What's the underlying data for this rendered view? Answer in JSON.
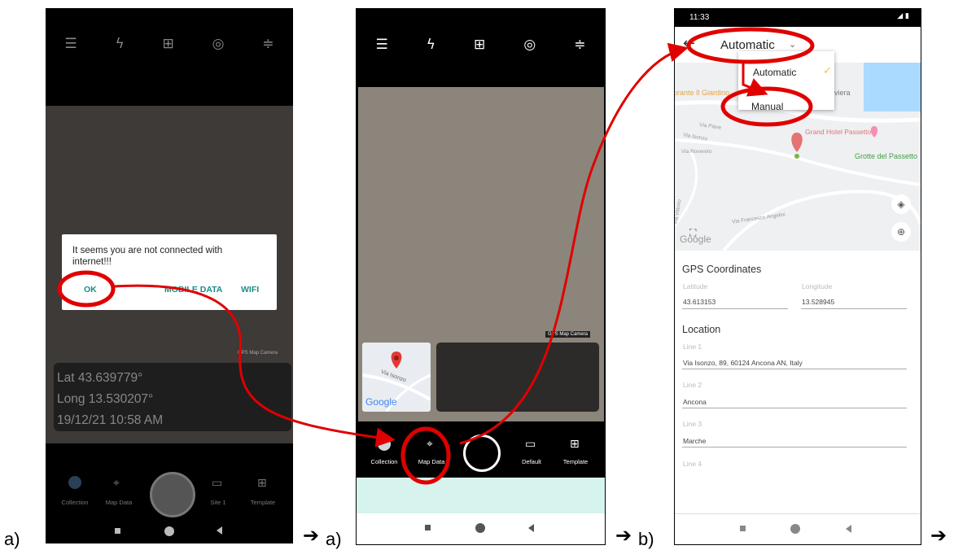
{
  "labels": {
    "a1": "a)",
    "a2": "a)",
    "b": "b)",
    "arrow": "➔"
  },
  "panel1": {
    "dialog": {
      "message": "It seems you are not connected with internet!!!",
      "ok": "OK",
      "mobile_data": "MOBILE DATA",
      "wifi": "WIFI"
    },
    "watermark": "GPS Map Camera",
    "info": {
      "lat": "Lat 43.639779°",
      "long": "Long 13.530207°",
      "datetime": "19/12/21 10:58 AM"
    },
    "nav": {
      "collection": "Collection",
      "map_data": "Map Data",
      "site": "Site 1",
      "template": "Template"
    }
  },
  "panel2": {
    "watermark": "GPS Map Camera",
    "map_street": "Via Isonzo",
    "map_logo": "Google",
    "nav": {
      "collection": "Collection",
      "map_data": "Map Data",
      "default": "Default",
      "template": "Template"
    }
  },
  "panel3": {
    "status_time": "11:33",
    "mode_selected": "Automatic",
    "menu": {
      "automatic": "Automatic",
      "manual": "Manual"
    },
    "map": {
      "place1": "orante Il Giardino",
      "place2": "viera",
      "place3": "Grand Hotel Passetto",
      "place4": "Grotte del Passetto",
      "street1": "Via Piave",
      "street2": "Via Isonzo",
      "street3": "Via Rovereto",
      "street4": "Via Francesco Angelini",
      "street5": "Via Vittorio",
      "logo": "Google"
    },
    "gps": {
      "title": "GPS Coordinates",
      "lat_label": "Latitude",
      "lat_value": "43.613153",
      "long_label": "Longitude",
      "long_value": "13.528945"
    },
    "location": {
      "title": "Location",
      "line1_label": "Line 1",
      "line1_value": "Via Isonzo, 89, 60124 Ancona AN, Italy",
      "line2_label": "Line 2",
      "line2_value": "Ancona",
      "line3_label": "Line 3",
      "line3_value": "Marche",
      "line4_label": "Line 4"
    }
  },
  "colors": {
    "highlight": "#e00000",
    "teal": "#1a8d87",
    "check": "#f5c518"
  }
}
